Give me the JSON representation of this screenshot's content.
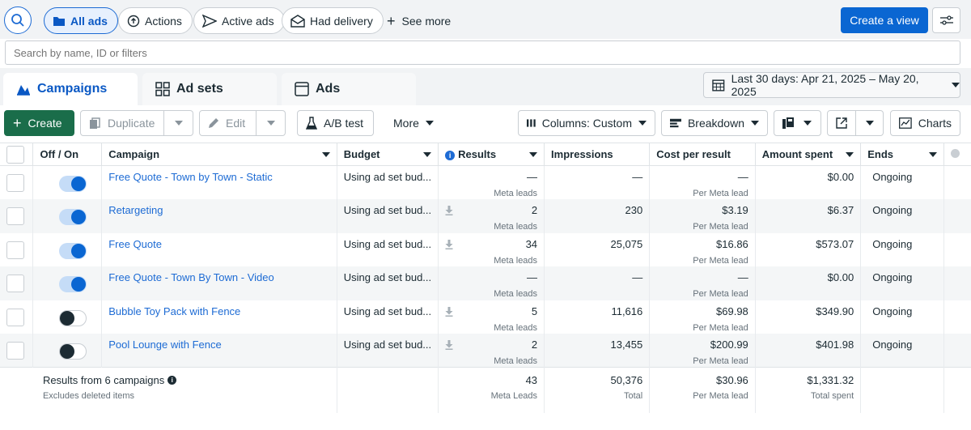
{
  "filters": {
    "search_icon": "search-icon",
    "pills": [
      {
        "label": "All ads",
        "icon": "folder-icon",
        "active": true
      },
      {
        "label": "Actions",
        "icon": "cursor-icon",
        "active": false
      },
      {
        "label": "Active ads",
        "icon": "send-icon",
        "active": false
      },
      {
        "label": "Had delivery",
        "icon": "envelope-icon",
        "active": false
      }
    ],
    "see_more": "See more",
    "create_view": "Create a view"
  },
  "search": {
    "placeholder": "Search by name, ID or filters"
  },
  "tabs": [
    {
      "label": "Campaigns",
      "active": true
    },
    {
      "label": "Ad sets",
      "active": false
    },
    {
      "label": "Ads",
      "active": false
    }
  ],
  "date_range": "Last 30 days: Apr 21, 2025 – May 20, 2025",
  "toolbar": {
    "create": "Create",
    "duplicate": "Duplicate",
    "edit": "Edit",
    "ab_test": "A/B test",
    "more": "More",
    "columns": "Columns: Custom",
    "breakdown": "Breakdown",
    "charts": "Charts"
  },
  "columns": [
    "Off / On",
    "Campaign",
    "Budget",
    "Results",
    "Impressions",
    "Cost per result",
    "Amount spent",
    "Ends"
  ],
  "rows": [
    {
      "on": true,
      "campaign": "Free Quote - Town by Town - Static",
      "budget": "Using ad set bud...",
      "results": "—",
      "results_sub": "Meta leads",
      "impressions": "—",
      "cost": "—",
      "cost_sub": "Per Meta lead",
      "spent": "$0.00",
      "ends": "Ongoing",
      "download": false
    },
    {
      "on": true,
      "campaign": "Retargeting",
      "budget": "Using ad set bud...",
      "results": "2",
      "results_sub": "Meta leads",
      "impressions": "230",
      "cost": "$3.19",
      "cost_sub": "Per Meta lead",
      "spent": "$6.37",
      "ends": "Ongoing",
      "download": true
    },
    {
      "on": true,
      "campaign": "Free Quote",
      "budget": "Using ad set bud...",
      "results": "34",
      "results_sub": "Meta leads",
      "impressions": "25,075",
      "cost": "$16.86",
      "cost_sub": "Per Meta lead",
      "spent": "$573.07",
      "ends": "Ongoing",
      "download": true
    },
    {
      "on": true,
      "campaign": "Free Quote - Town By Town - Video",
      "budget": "Using ad set bud...",
      "results": "—",
      "results_sub": "Meta leads",
      "impressions": "—",
      "cost": "—",
      "cost_sub": "Per Meta lead",
      "spent": "$0.00",
      "ends": "Ongoing",
      "download": false
    },
    {
      "on": false,
      "campaign": "Bubble Toy Pack with Fence",
      "budget": "Using ad set bud...",
      "results": "5",
      "results_sub": "Meta leads",
      "impressions": "11,616",
      "cost": "$69.98",
      "cost_sub": "Per Meta lead",
      "spent": "$349.90",
      "ends": "Ongoing",
      "download": true
    },
    {
      "on": false,
      "campaign": "Pool Lounge with Fence",
      "budget": "Using ad set bud...",
      "results": "2",
      "results_sub": "Meta leads",
      "impressions": "13,455",
      "cost": "$200.99",
      "cost_sub": "Per Meta lead",
      "spent": "$401.98",
      "ends": "Ongoing",
      "download": true
    }
  ],
  "summary": {
    "title": "Results from 6 campaigns",
    "subtitle": "Excludes deleted items",
    "results": "43",
    "results_sub": "Meta Leads",
    "impressions": "50,376",
    "impressions_sub": "Total",
    "cost": "$30.96",
    "cost_sub": "Per Meta lead",
    "spent": "$1,331.32",
    "spent_sub": "Total spent"
  },
  "colors": {
    "accent": "#0a66d2",
    "create_green": "#1a6d4a",
    "link": "#1d6bd4"
  }
}
